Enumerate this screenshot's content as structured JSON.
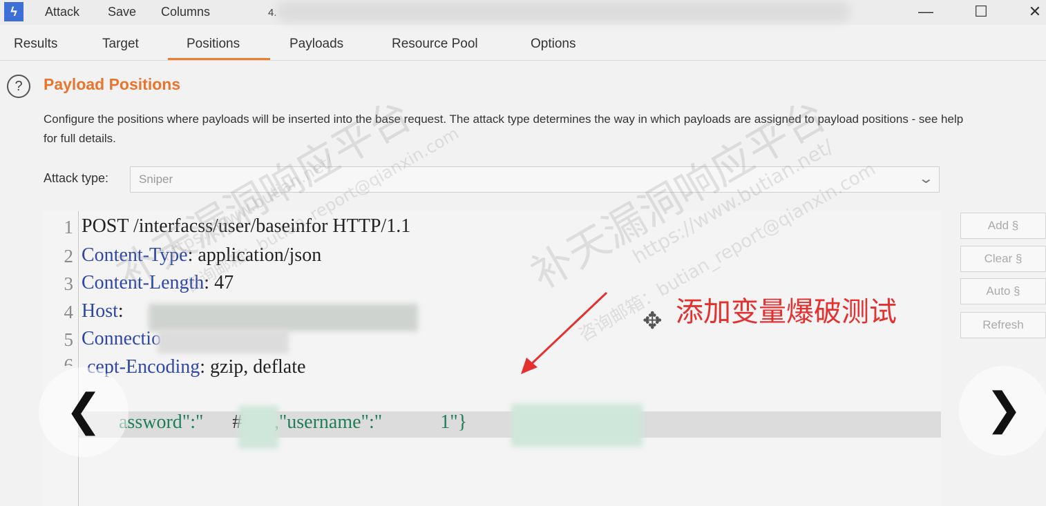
{
  "menubar": {
    "app_icon": "burp-lightning-icon",
    "items": [
      "Attack",
      "Save",
      "Columns"
    ],
    "title_fragment": "4."
  },
  "window_controls": {
    "minimize": "—",
    "maximize": "☐",
    "close": "✕"
  },
  "tabs": [
    "Results",
    "Target",
    "Positions",
    "Payloads",
    "Resource Pool",
    "Options"
  ],
  "active_tab": "Positions",
  "section": {
    "help_icon": "?",
    "title": "Payload Positions",
    "description": "Configure the positions where payloads will be inserted into the base request. The attack type determines the way in which payloads are assigned to payload positions - see help for full details."
  },
  "attack_type": {
    "label": "Attack type:",
    "value": "Sniper"
  },
  "request": {
    "line_numbers": [
      "1",
      "2",
      "3",
      "4",
      "5",
      "6"
    ],
    "line1": "POST /interfacss/user/baseinfor HTTP/1.1",
    "line2_key": "Content-Type",
    "line2_value": ": application/json",
    "line3_key": "Content-Length",
    "line3_value": ": 47",
    "line4_key": "Host",
    "line4_value": ":",
    "line5_key": "Connection",
    "line6_key": "cept-Encoding",
    "line6_value": ": gzip, deflate",
    "body_prefix": "assword\":\"",
    "body_hash": "#",
    "body_payload": "§ §",
    "body_mid": "\",\"username\":\"",
    "body_end": "1\"}"
  },
  "buttons": {
    "add": "Add §",
    "clear": "Clear §",
    "auto": "Auto §",
    "refresh": "Refresh"
  },
  "nav": {
    "prev": "❮",
    "next": "❯"
  },
  "annotation": {
    "text": "添加变量爆破测试",
    "color": "#e53030"
  },
  "watermarks": {
    "site_cn": "补天漏洞响应平台",
    "url": "https://www.butian.net/",
    "email": "咨询邮箱：butian_report@qianxin.com"
  },
  "colors": {
    "accent": "#e7752d",
    "payload": "#1f7e58",
    "header_key": "#2d46a8"
  }
}
